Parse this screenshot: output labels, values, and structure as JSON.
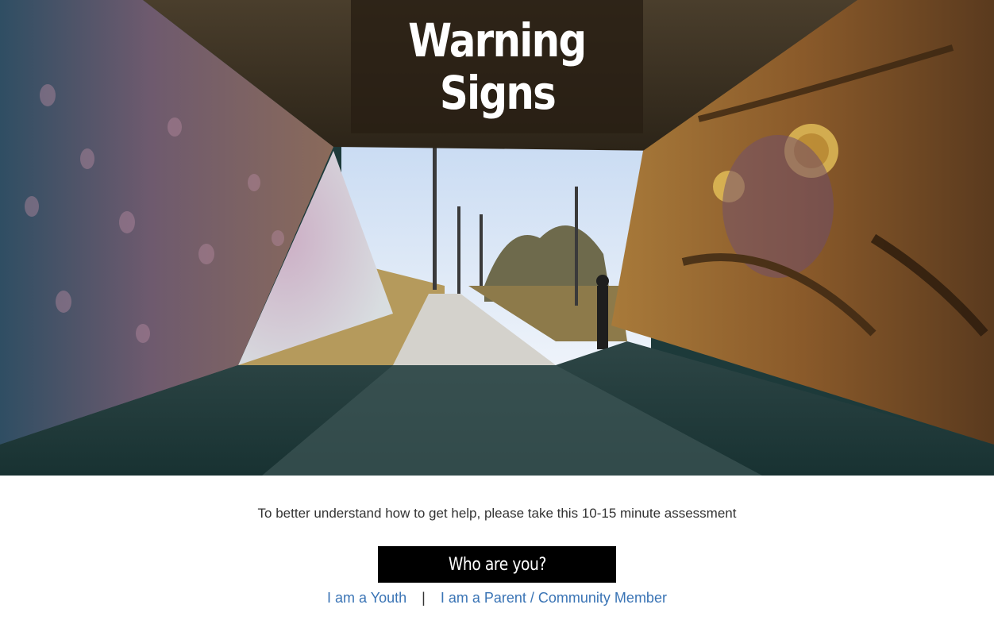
{
  "hero": {
    "title_line1": "Warning",
    "title_line2": "Signs",
    "image_alt": "Graffiti-covered underpass tunnel opening onto a paved trail"
  },
  "content": {
    "instructions": "To better understand how to get help, please take this 10-15 minute assessment",
    "who_heading": "Who are you?",
    "choices": [
      {
        "label": "I am a Youth"
      },
      {
        "label": "I am a Parent / Community Member"
      }
    ],
    "separator": "|"
  },
  "colors": {
    "link": "#3a74b5",
    "heading_bg": "#000000",
    "title_box_bg": "#281e14"
  }
}
